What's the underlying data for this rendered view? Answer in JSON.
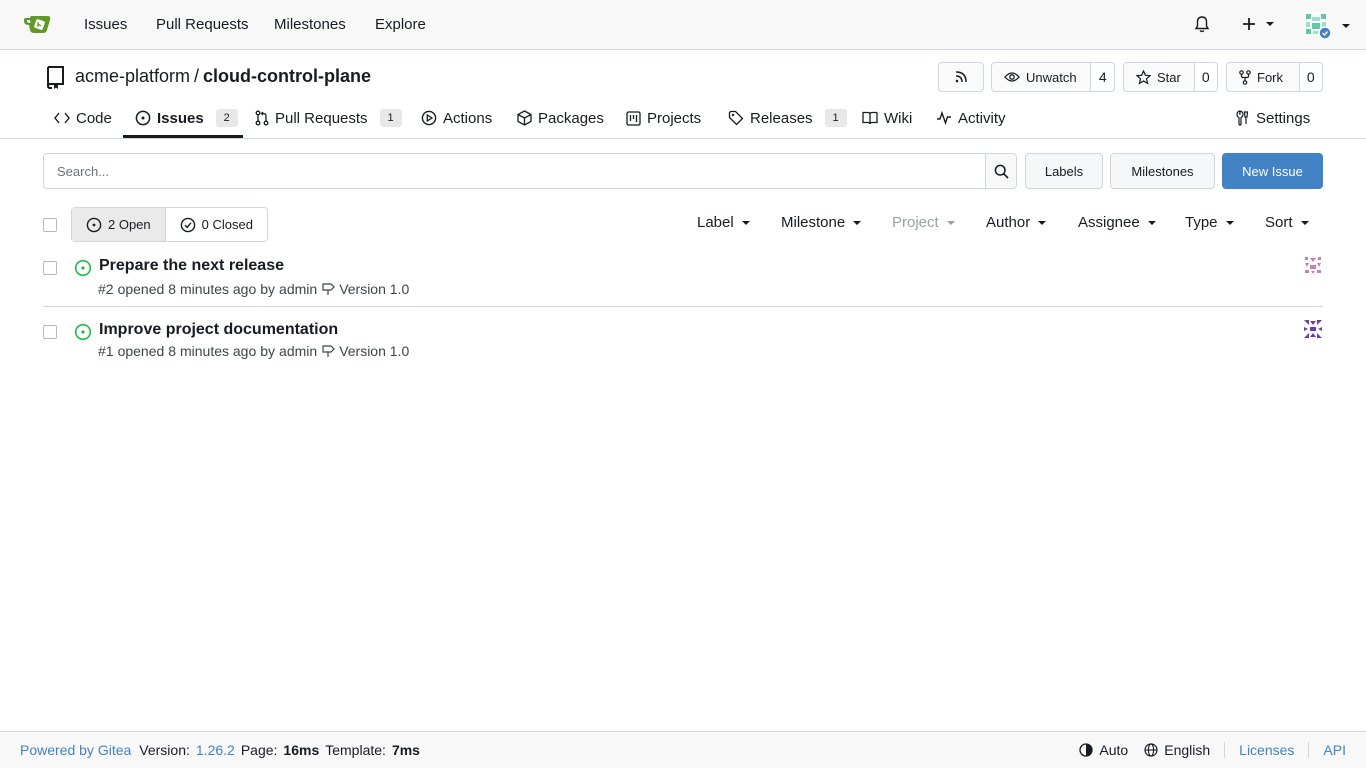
{
  "navbar": {
    "links": [
      "Issues",
      "Pull Requests",
      "Milestones",
      "Explore"
    ]
  },
  "repo": {
    "owner": "acme-platform",
    "separator": "/",
    "name": "cloud-control-plane",
    "unwatch_label": "Unwatch",
    "watch_count": "4",
    "star_label": "Star",
    "star_count": "0",
    "fork_label": "Fork",
    "fork_count": "0"
  },
  "tabs": {
    "code": "Code",
    "issues": "Issues",
    "issues_count": "2",
    "pulls": "Pull Requests",
    "pulls_count": "1",
    "actions": "Actions",
    "packages": "Packages",
    "projects": "Projects",
    "releases": "Releases",
    "releases_count": "1",
    "wiki": "Wiki",
    "activity": "Activity",
    "settings": "Settings"
  },
  "toolbar": {
    "search_placeholder": "Search...",
    "labels": "Labels",
    "milestones": "Milestones",
    "new_issue": "New Issue"
  },
  "filters": {
    "open": "2 Open",
    "closed": "0 Closed",
    "label": "Label",
    "milestone": "Milestone",
    "project": "Project",
    "author": "Author",
    "assignee": "Assignee",
    "type": "Type",
    "sort": "Sort"
  },
  "issues": [
    {
      "title": "Prepare the next release",
      "number": "#2",
      "opened": "opened",
      "time": "8 minutes ago",
      "by": "by",
      "author": "admin",
      "milestone": "Version 1.0"
    },
    {
      "title": "Improve project documentation",
      "number": "#1",
      "opened": "opened",
      "time": "8 minutes ago",
      "by": "by",
      "author": "admin",
      "milestone": "Version 1.0"
    }
  ],
  "footer": {
    "powered": "Powered by Gitea",
    "version_label": "Version:",
    "version": "1.26.2",
    "page_label": "Page:",
    "page_time": "16ms",
    "template_label": "Template:",
    "template_time": "7ms",
    "theme": "Auto",
    "language": "English",
    "licenses": "Licenses",
    "api": "API"
  },
  "colors": {
    "accent": "#4183c4",
    "open_status": "#21ba45",
    "brand": "#609926"
  }
}
